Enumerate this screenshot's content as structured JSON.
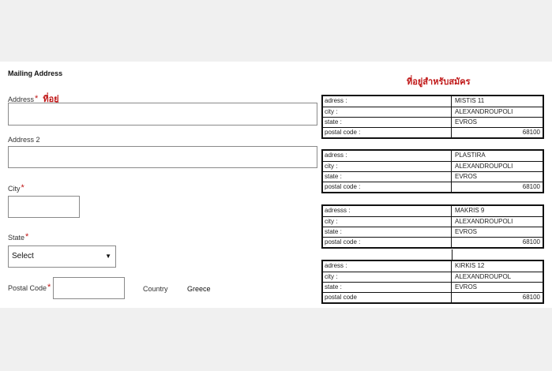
{
  "form": {
    "section_title": "Mailing Address",
    "address_label": "Address",
    "address_note": "ที่อยู่",
    "address2_label": "Address 2",
    "city_label": "City",
    "state_label": "State",
    "state_value": "Select",
    "postal_label": "Postal Code",
    "country_label": "Country",
    "country_value": "Greece",
    "required_mark": "*"
  },
  "applicant_heading": "ที่อยู่สำหรับสมัคร",
  "addresses": [
    {
      "k1": "adress :",
      "v1": "MISTIS 11",
      "k2": "city :",
      "v2": "ALEXANDROUPOLI",
      "k3": "state :",
      "v3": "EVROS",
      "k4": "postal code :",
      "v4": "68100"
    },
    {
      "k1": "adress :",
      "v1": "PLASTIRA",
      "k2": "city :",
      "v2": "ALEXANDROUPOLI",
      "k3": "state :",
      "v3": "EVROS",
      "k4": "postal code :",
      "v4": "68100"
    },
    {
      "k1": "adresss :",
      "v1": "MAKRIS 9",
      "k2": "city :",
      "v2": "ALEXANDROUPOLI",
      "k3": "state :",
      "v3": "EVROS",
      "k4": "postal code :",
      "v4": "68100"
    },
    {
      "k1": "adress :",
      "v1": "KIRKIS 12",
      "k2": "city :",
      "v2": "ALEXANDROUPOL",
      "k3": "state :",
      "v3": "EVROS",
      "k4": "postal code",
      "v4": "68100"
    }
  ],
  "icons": {
    "select_arrow": "chevron-down-icon"
  }
}
